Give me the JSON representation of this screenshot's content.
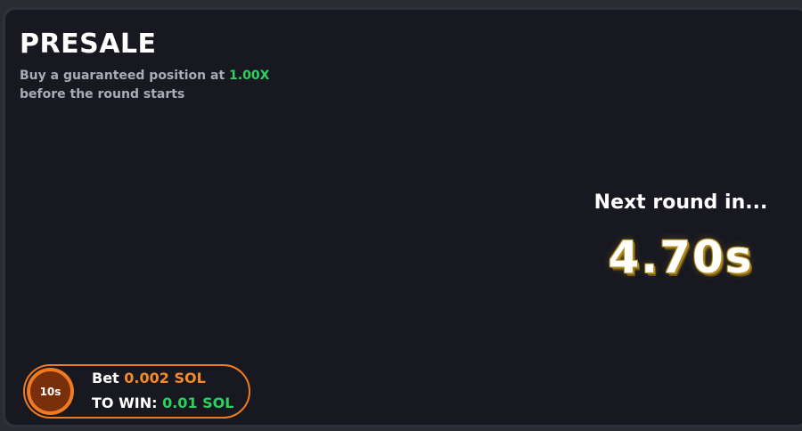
{
  "presale": {
    "title": "PRESALE",
    "subtitle_prefix": "Buy a guaranteed position at ",
    "multiplier": "1.00X",
    "subtitle_suffix": "before the round starts"
  },
  "round": {
    "next_label": "Next round in...",
    "countdown": "4.70s"
  },
  "bet": {
    "badge": "10s",
    "bet_label": "Bet",
    "bet_amount": "0.002 SOL",
    "win_label": "TO WIN:",
    "win_amount": "0.01 SOL"
  },
  "colors": {
    "background": "#171820",
    "accent_orange": "#f07a1f",
    "accent_green": "#2bd15f",
    "countdown_outline": "#b0891e"
  }
}
